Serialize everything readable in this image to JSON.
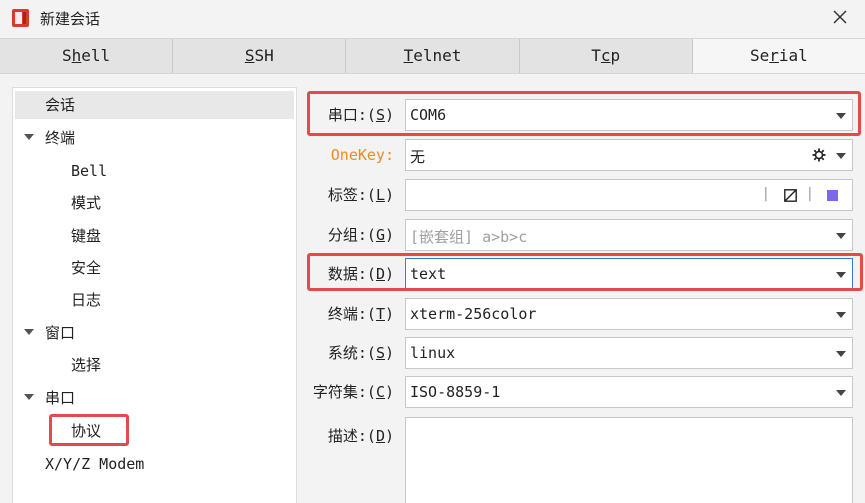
{
  "window": {
    "title": "新建会话",
    "app_icon": "app-icon",
    "close_icon": "close-icon"
  },
  "tabs": [
    {
      "label": "Shell",
      "underline": "h",
      "pre": "S",
      "post": "ell"
    },
    {
      "label": "SSH",
      "underline": "S",
      "pre": "",
      "post": "SH"
    },
    {
      "label": "Telnet",
      "underline": "T",
      "pre": "",
      "post": "elnet"
    },
    {
      "label": "Tcp",
      "underline": "c",
      "pre": "T",
      "post": "p"
    },
    {
      "label": "Serial",
      "underline": "r",
      "pre": "Se",
      "post": "ial"
    }
  ],
  "tree": {
    "session": "会话",
    "terminal": "终端",
    "bell": "Bell",
    "mode": "模式",
    "keyboard": "键盘",
    "security": "安全",
    "log": "日志",
    "window": "窗口",
    "select": "选择",
    "serial": "串口",
    "protocol": "协议",
    "xyz": "X/Y/Z Modem"
  },
  "form": {
    "port": {
      "label_pre": "串口:(",
      "key": "S",
      "label_post": ")",
      "value": "COM6"
    },
    "onekey": {
      "label": "OneKey:",
      "value": "无"
    },
    "tag": {
      "label_pre": "标签:(",
      "key": "L",
      "label_post": ")",
      "value": "",
      "tool1": "|",
      "tool3": "|"
    },
    "group": {
      "label_pre": "分组:(",
      "key": "G",
      "label_post": ")",
      "placeholder": "[嵌套组] a>b>c"
    },
    "data": {
      "label_pre": "数据:(",
      "key": "D",
      "label_post": ")",
      "value": "text"
    },
    "terminal": {
      "label_pre": "终端:(",
      "key": "T",
      "label_post": ")",
      "value": "xterm-256color"
    },
    "system": {
      "label_pre": "系统:(",
      "key": "S",
      "label_post": ")",
      "value": "linux"
    },
    "charset": {
      "label_pre": "字符集:(",
      "key": "C",
      "label_post": ")",
      "value": "ISO-8859-1"
    },
    "desc": {
      "label_pre": "描述:(",
      "key": "D",
      "label_post": ")",
      "value": ""
    }
  },
  "colors": {
    "highlight": "#e34b4b",
    "onekey": "#ef8a1f",
    "color_swatch": "#7b68ee"
  }
}
